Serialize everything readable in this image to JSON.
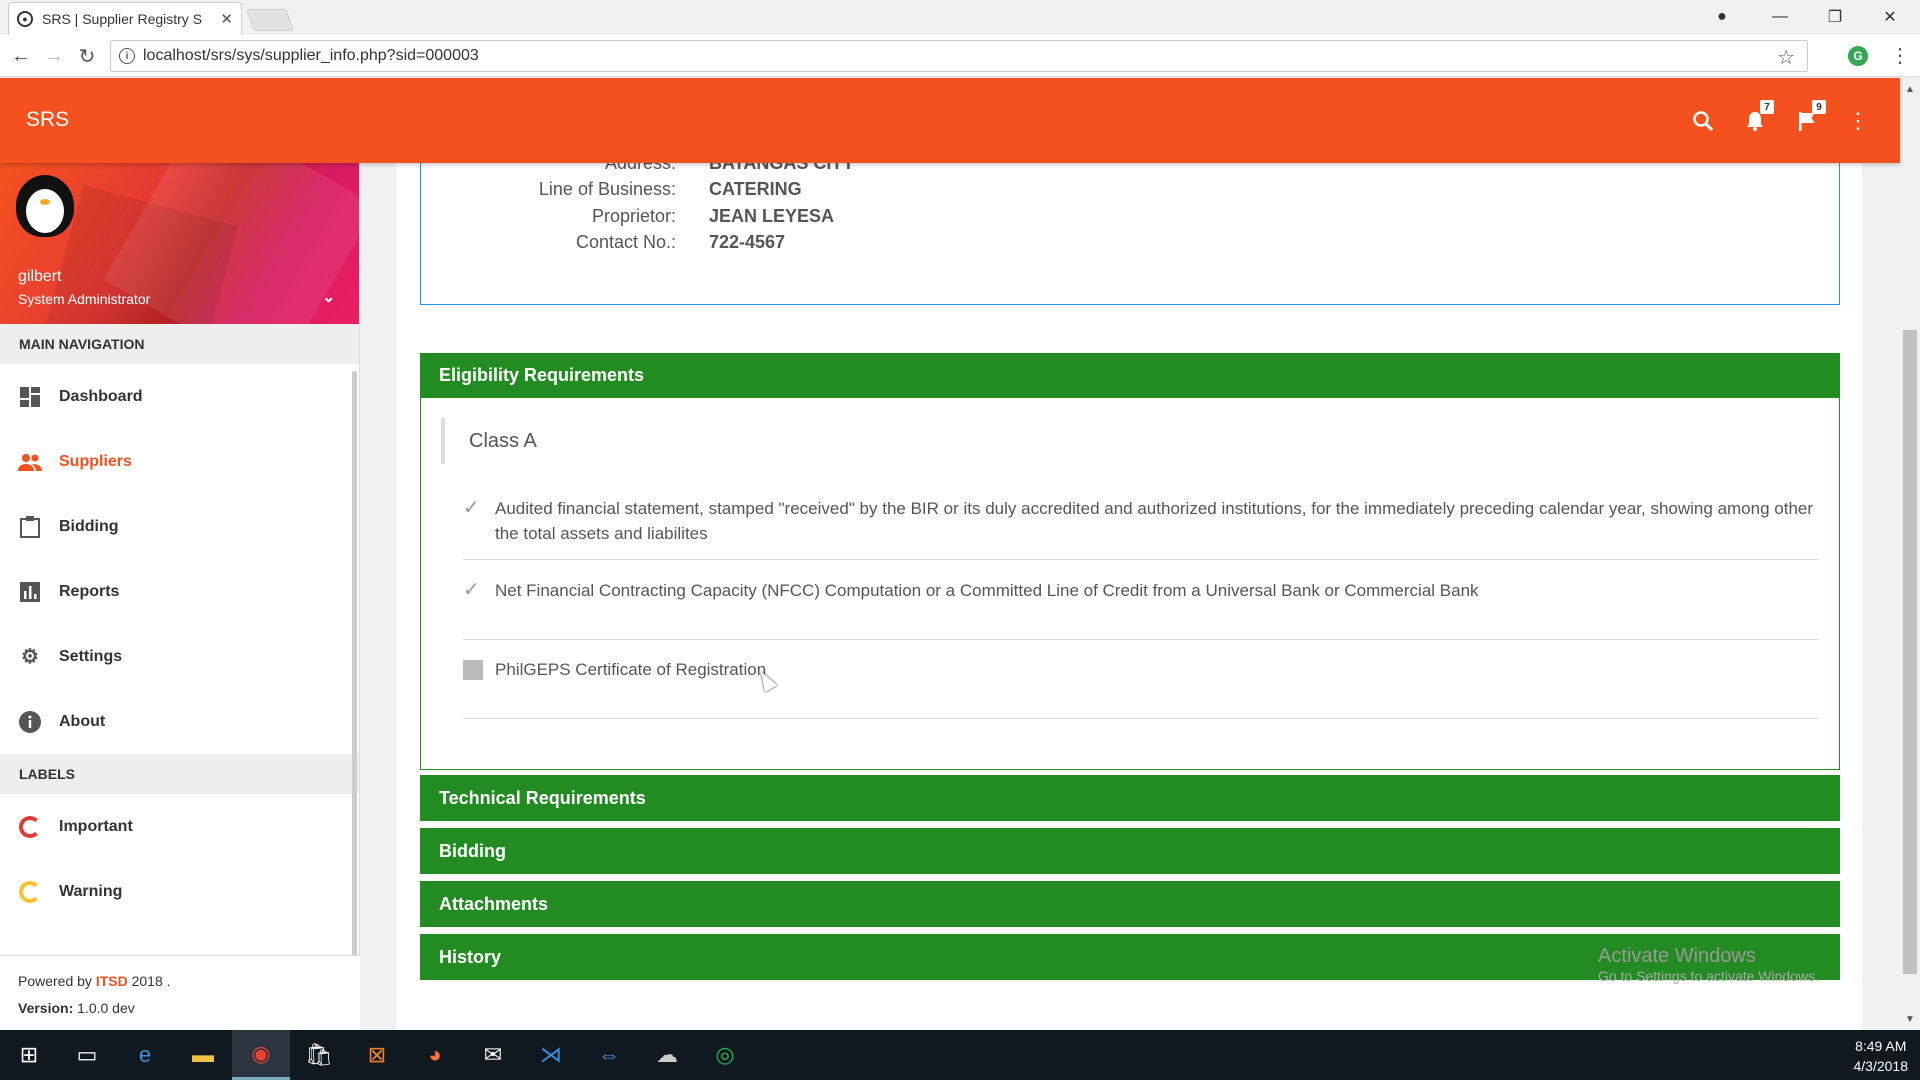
{
  "browser": {
    "tab_title": "SRS | Supplier Registry S",
    "url": "localhost/srs/sys/supplier_info.php?sid=000003"
  },
  "appbar": {
    "brand": "SRS",
    "notifications_count": "7",
    "flags_count": "9",
    "accent_color": "#f4511e"
  },
  "user": {
    "name": "gilbert",
    "role": "System Administrator"
  },
  "sidebar": {
    "main_nav_header": "MAIN NAVIGATION",
    "items": [
      {
        "label": "Dashboard",
        "icon": "dashboard-icon"
      },
      {
        "label": "Suppliers",
        "icon": "people-icon",
        "active": true
      },
      {
        "label": "Bidding",
        "icon": "clipboard-icon"
      },
      {
        "label": "Reports",
        "icon": "bar-chart-icon"
      },
      {
        "label": "Settings",
        "icon": "gear-icon"
      },
      {
        "label": "About",
        "icon": "info-icon"
      }
    ],
    "labels_header": "LABELS",
    "labels": [
      {
        "label": "Important",
        "color": "#e53935"
      },
      {
        "label": "Warning",
        "color": "#fbc02d"
      }
    ]
  },
  "footer": {
    "powered_prefix": "Powered by ",
    "org": "ITSD",
    "year_suffix": " 2018 .",
    "version_label": "Version:",
    "version_value": " 1.0.0 dev"
  },
  "supplier": {
    "address_label": "Address:",
    "address": "BATANGAS CITY",
    "lob_label": "Line of Business:",
    "lob": "CATERING",
    "proprietor_label": "Proprietor:",
    "proprietor": "JEAN LEYESA",
    "contact_label": "Contact No.:",
    "contact": "722-4567"
  },
  "panels": {
    "eligibility": "Eligibility Requirements",
    "technical": "Technical Requirements",
    "bidding": "Bidding",
    "attachments": "Attachments",
    "history": "History",
    "panel_color": "#228b22"
  },
  "eligibility": {
    "class_title": "Class A",
    "requirements": [
      {
        "text": "Audited financial statement, stamped \"received\" by the BIR or its duly accredited and authorized institutions, for the immediately preceding calendar year, showing among other the total assets and liabilites",
        "checked": true
      },
      {
        "text": "Net Financial Contracting Capacity (NFCC) Computation or a Committed Line of Credit from a Universal Bank or Commercial Bank",
        "checked": true
      },
      {
        "text": "PhilGEPS Certificate of Registration",
        "checked": false
      }
    ]
  },
  "watermark": {
    "title": "Activate Windows",
    "subtitle": "Go to Settings to activate Windows."
  },
  "clock": {
    "time": "8:49 AM",
    "date": "4/3/2018"
  }
}
